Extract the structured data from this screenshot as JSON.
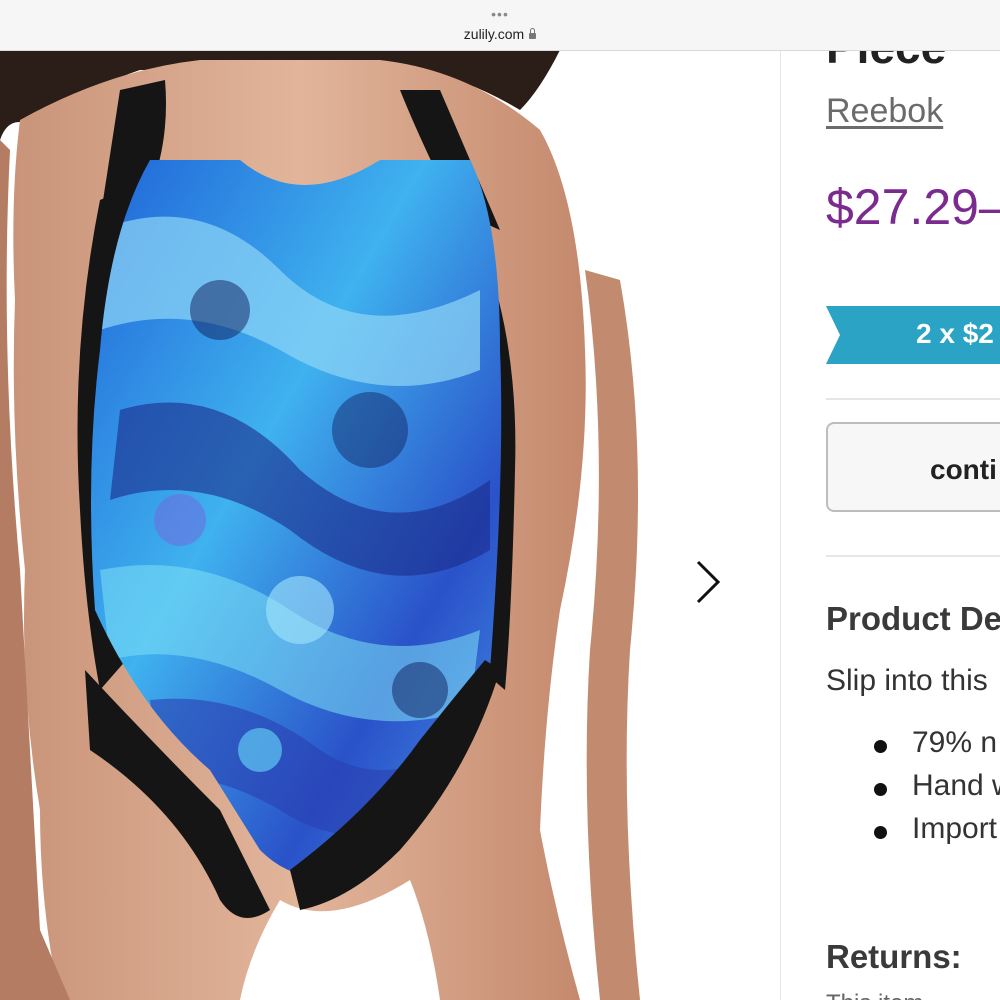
{
  "browser": {
    "more_dots": "•••",
    "url": "zulily.com",
    "lock_icon": "lock-icon"
  },
  "product": {
    "title_fragment": "Piece",
    "brand": "Reebok",
    "price": "$27.29–",
    "promo": "2 x $2",
    "promo_color": "#2aa3c4",
    "price_color": "#7b2a8e",
    "continue_label": "conti",
    "details_heading": "Product De",
    "description_start": "Slip into this",
    "bullets": [
      "79% n",
      "Hand w",
      "Import"
    ],
    "returns_heading": "Returns:",
    "returns_sub": "This item"
  },
  "gallery": {
    "next_icon": "chevron-right-icon"
  }
}
